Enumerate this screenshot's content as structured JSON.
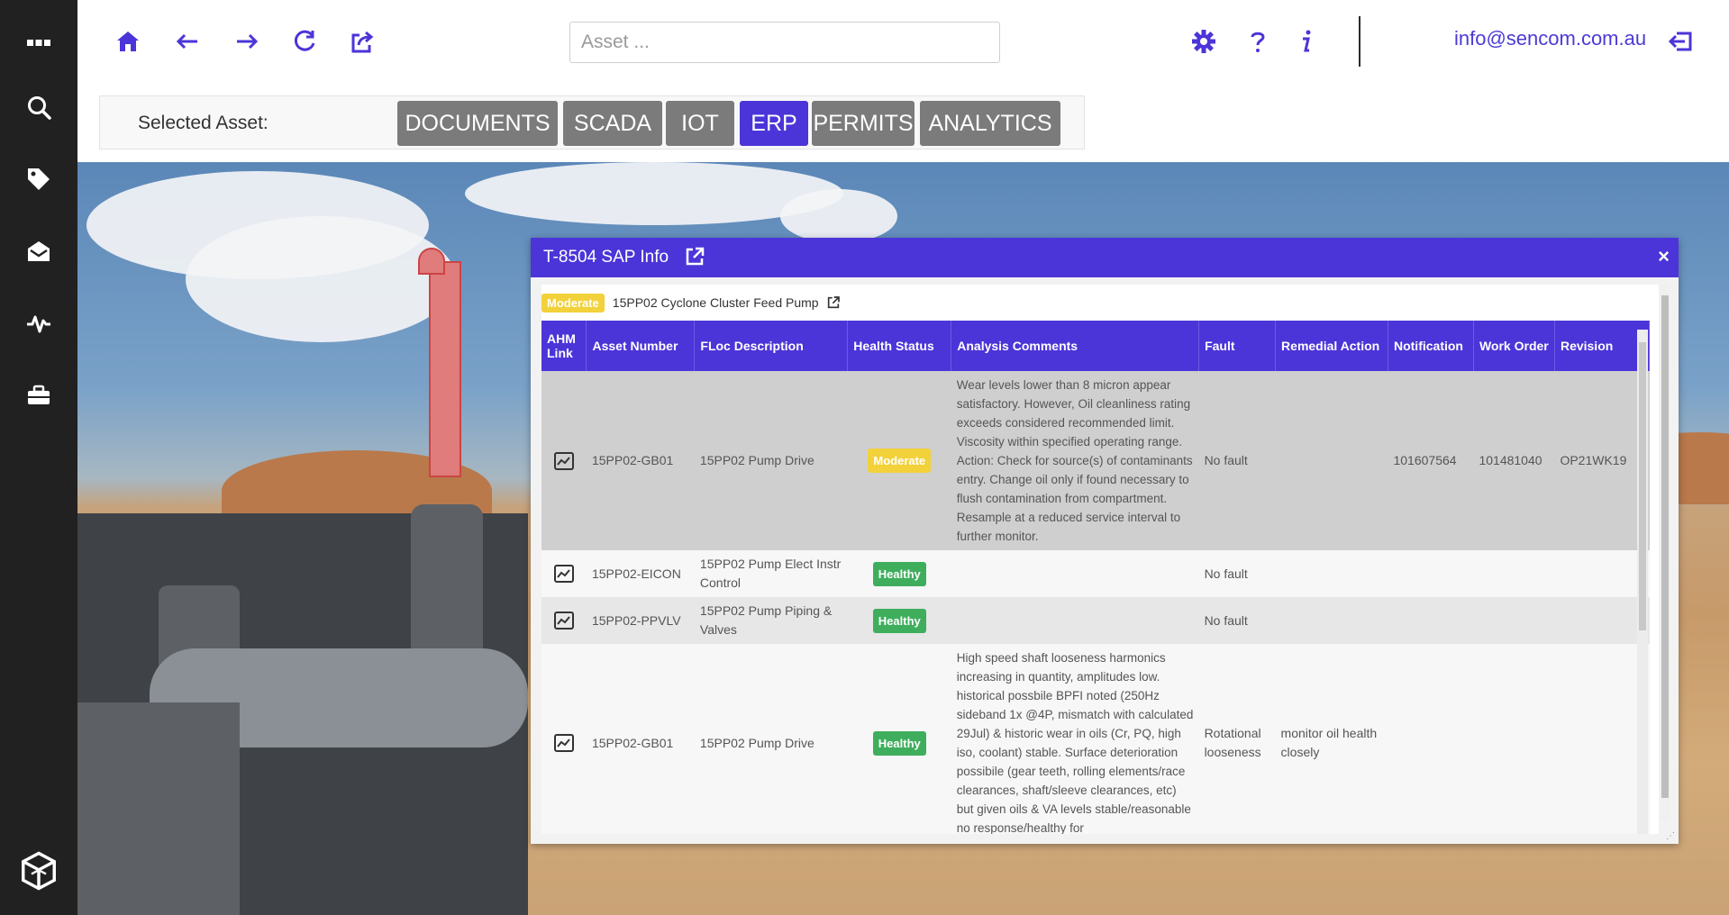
{
  "topbar": {
    "search_placeholder": "Asset ...",
    "user_email": "info@sencom.com.au"
  },
  "asset_bar": {
    "label": "Selected Asset:",
    "tabs": [
      "DOCUMENTS",
      "SCADA",
      "IOT",
      "ERP",
      "PERMITS",
      "ANALYTICS"
    ],
    "active_tab": "ERP"
  },
  "dialog": {
    "title": "T-8504 SAP Info",
    "close": "×",
    "summary_badge": "Moderate",
    "summary_text": "15PP02 Cyclone Cluster Feed Pump",
    "columns": [
      "AHM Link",
      "Asset Number",
      "FLoc Description",
      "Health Status",
      "Analysis Comments",
      "Fault",
      "Remedial Action",
      "Notification",
      "Work Order",
      "Revision"
    ],
    "rows": [
      {
        "asset_number": "15PP02-GB01",
        "floc": "15PP02 Pump Drive",
        "health": "Moderate",
        "comments": "Wear levels lower than 8 micron appear satisfactory. However, Oil cleanliness rating exceeds considered recommended limit. Viscosity within specified operating range.  Action: Check for source(s) of contaminants entry. Change oil only if found necessary to flush contamination from compartment. Resample at a reduced service interval to further monitor.",
        "fault": "No fault",
        "remedial": "",
        "notification": "101607564",
        "work_order": "101481040",
        "revision": "OP21WK19"
      },
      {
        "asset_number": "15PP02-EICON",
        "floc": "15PP02 Pump Elect Instr Control",
        "health": "Healthy",
        "comments": "",
        "fault": "No fault",
        "remedial": "",
        "notification": "",
        "work_order": "",
        "revision": ""
      },
      {
        "asset_number": "15PP02-PPVLV",
        "floc": "15PP02 Pump Piping & Valves",
        "health": "Healthy",
        "comments": "",
        "fault": "No fault",
        "remedial": "",
        "notification": "",
        "work_order": "",
        "revision": ""
      },
      {
        "asset_number": "15PP02-GB01",
        "floc": "15PP02 Pump Drive",
        "health": "Healthy",
        "comments": "High speed shaft looseness harmonics increasing in quantity, amplitudes low. historical possbile BPFI noted (250Hz sideband 1x @4P, mismatch with calculated 29Jul) & historic wear in oils (Cr, PQ, high iso, coolant) stable. Surface deterioration possibile (gear teeth, rolling elements/race clearances, shaft/sleeve clearances, etc) but given oils & VA levels stable/reasonable no response/healthy for",
        "fault": "Rotational looseness",
        "remedial": "monitor oil health closely",
        "notification": "",
        "work_order": "",
        "revision": ""
      }
    ]
  },
  "colors": {
    "accent": "#4b35d8",
    "sidebar": "#212121",
    "moderate": "#f2d13b",
    "healthy": "#3eae5d"
  }
}
